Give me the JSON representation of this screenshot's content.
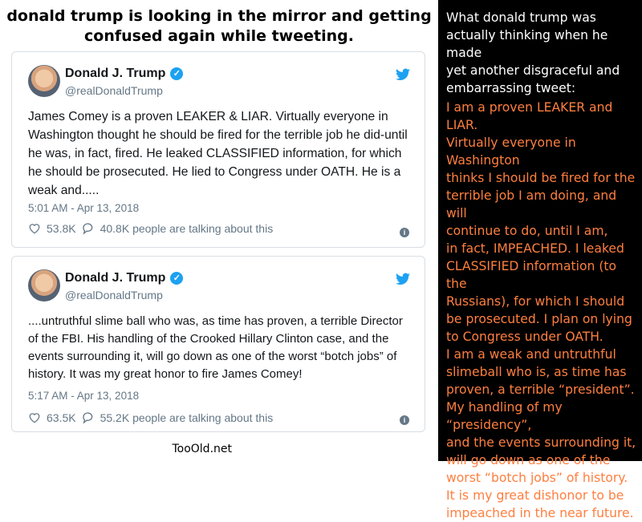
{
  "headline": "donald trump is looking in the mirror and getting confused again while tweeting.",
  "tweets": [
    {
      "name": "Donald J. Trump",
      "handle": "@realDonaldTrump",
      "text": "James Comey is a proven LEAKER & LIAR. Virtually everyone in Washington thought he should be fired for the terrible job he did-until he was, in fact, fired. He leaked CLASSIFIED information, for which he should be prosecuted. He lied to Congress under OATH. He is a weak and.....",
      "timestamp": "5:01 AM - Apr 13, 2018",
      "likes": "53.8K",
      "talking": "40.8K people are talking about this"
    },
    {
      "name": "Donald J. Trump",
      "handle": "@realDonaldTrump",
      "text": "....untruthful slime ball who was, as time has proven, a terrible Director of the FBI. His handling of the Crooked Hillary Clinton case, and the events surrounding it, will go down as one of the worst “botch jobs” of history. It was my great honor to fire James Comey!",
      "timestamp": "5:17 AM - Apr 13, 2018",
      "likes": "63.5K",
      "talking": "55.2K people are talking about this"
    }
  ],
  "watermark": "TooOld.net",
  "right_panel": {
    "caption": "What donald trump was\nactually thinking when he made\nyet another disgraceful and\nembarrassing tweet:",
    "rewrite": "I am a proven LEAKER and LIAR.\nVirtually everyone in Washington\nthinks I should be fired for the\nterrible job I am doing, and will\ncontinue to do, until I am,\nin fact, IMPEACHED. I leaked\nCLASSIFIED information (to the\nRussians), for which I should\nbe prosecuted. I plan on lying\nto Congress under OATH.\nI am a weak and untruthful\nslimeball who is, as time has\nproven, a terrible “president”.\nMy handling of my “presidency”,\nand the events surrounding it,\nwill go down as one of the\nworst “botch jobs” of history.\nIt is my great dishonor to be\nimpeached in the near future."
  },
  "colors": {
    "twitter_blue": "#1da1f2",
    "muted_text": "#657786",
    "right_panel_bg": "#000000",
    "rewrite_orange": "#ff7f3f"
  },
  "icons": [
    "verified-badge-icon",
    "twitter-bird-icon",
    "heart-icon",
    "comment-bubble-icon",
    "info-icon"
  ]
}
